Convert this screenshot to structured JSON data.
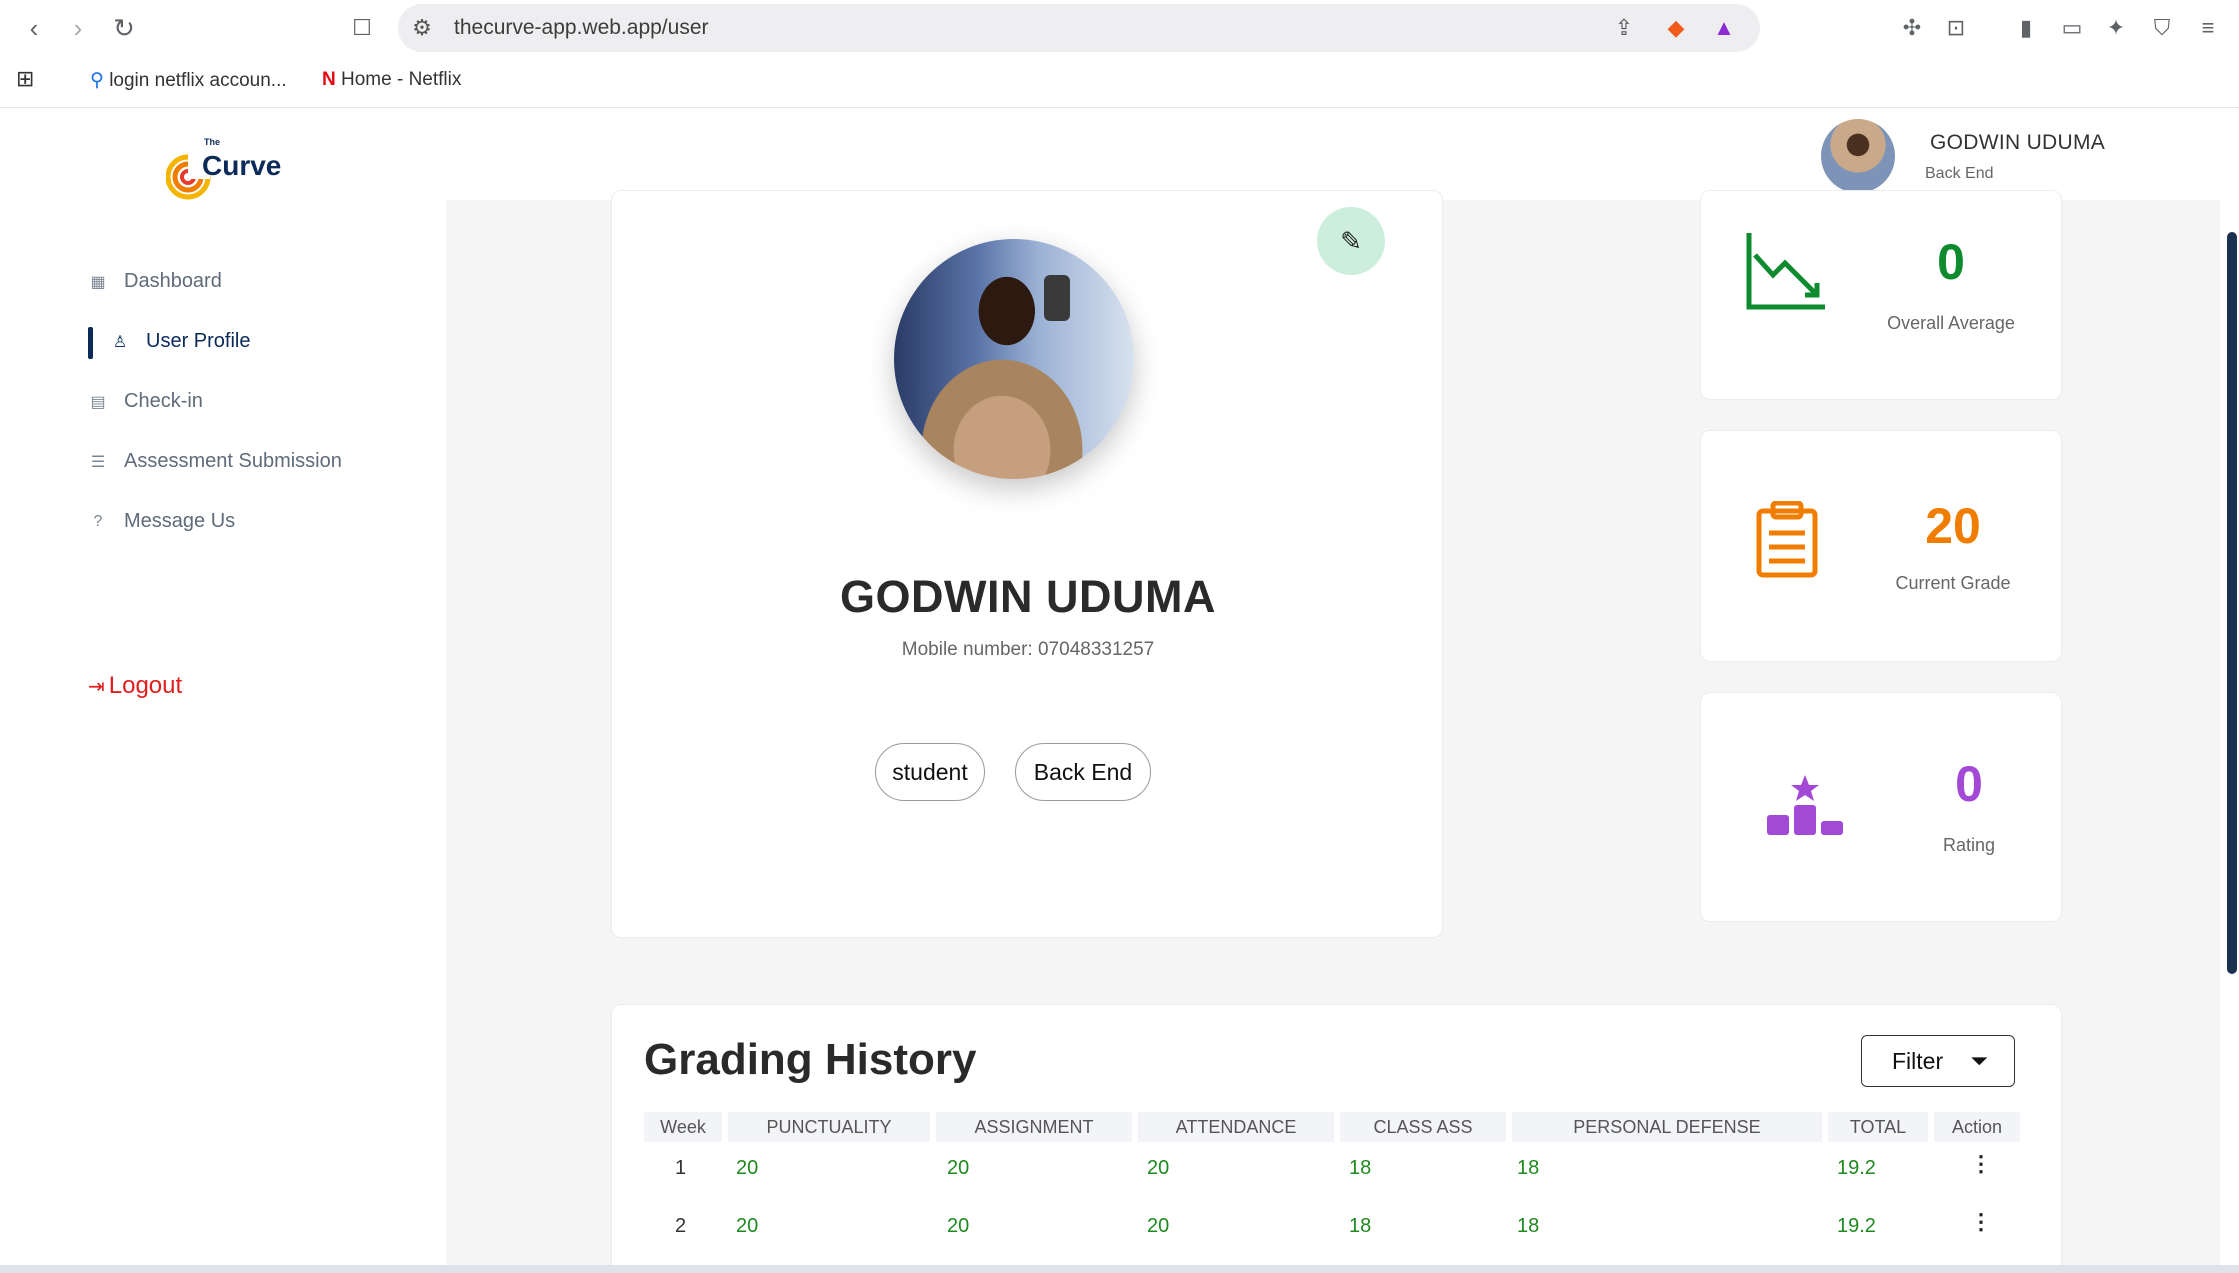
{
  "browser": {
    "url": "thecurve-app.web.app/user",
    "bookmarks": [
      {
        "label": "login netflix accoun..."
      },
      {
        "label": "Home - Netflix"
      }
    ]
  },
  "header": {
    "logo_text": "The Curve",
    "user_name": "GODWIN UDUMA",
    "user_role": "Back End"
  },
  "sidebar": {
    "items": [
      {
        "label": "Dashboard",
        "icon": "grid-icon"
      },
      {
        "label": "User Profile",
        "icon": "user-icon"
      },
      {
        "label": "Check-in",
        "icon": "calendar-icon"
      },
      {
        "label": "Assessment Submission",
        "icon": "checklist-icon"
      },
      {
        "label": "Message Us",
        "icon": "help-circle-icon"
      }
    ],
    "logout_label": "Logout"
  },
  "profile": {
    "name": "GODWIN UDUMA",
    "mobile": "Mobile number: 07048331257",
    "tags": [
      "student",
      "Back End"
    ]
  },
  "stats": [
    {
      "value": "0",
      "label": "Overall Average",
      "color": "#0e8a2f",
      "icon": "trend-down-chart-icon"
    },
    {
      "value": "20",
      "label": "Current Grade",
      "color": "#f07d00",
      "icon": "clipboard-icon"
    },
    {
      "value": "0",
      "label": "Rating",
      "color": "#a24ad6",
      "icon": "podium-star-icon"
    }
  ],
  "grading": {
    "title": "Grading History",
    "filter_label": "Filter",
    "columns": [
      "Week",
      "PUNCTUALITY",
      "ASSIGNMENT",
      "ATTENDANCE",
      "CLASS ASS",
      "PERSONAL DEFENSE",
      "TOTAL",
      "Action"
    ],
    "rows": [
      {
        "week": "1",
        "punctuality": "20",
        "assignment": "20",
        "attendance": "20",
        "class_ass": "18",
        "personal_defense": "18",
        "total": "19.2"
      },
      {
        "week": "2",
        "punctuality": "20",
        "assignment": "20",
        "attendance": "20",
        "class_ass": "18",
        "personal_defense": "18",
        "total": "19.2"
      }
    ]
  }
}
